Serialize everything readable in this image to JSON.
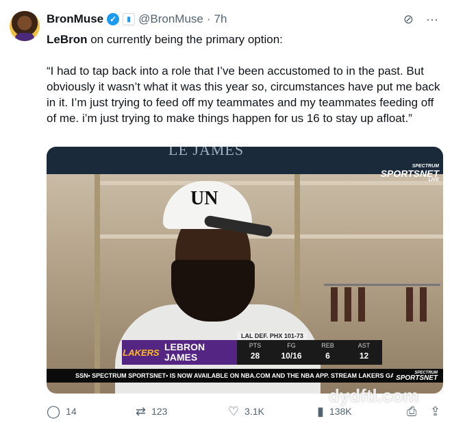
{
  "author": {
    "display_name": "BronMuse",
    "handle": "@BronMuse",
    "separator": "·",
    "time": "7h"
  },
  "tweet": {
    "lead_name": "LeBron",
    "lead_rest": " on currently being the primary option:",
    "quote": "“I had to tap back into a role that I’ve been accustomed to in the past. But obviously it wasn’t what it was this year so, circumstances have put me back in it. I’m just trying to feed off my teammates and my teammates feeding off of me. i’m just trying to make things happen for us 16 to stay up afloat.”"
  },
  "media": {
    "locker_nameplate": "LE JAMES",
    "cap_text": "UN",
    "broadcaster_logo_small": "SPECTRUM",
    "broadcaster_logo_big": "SPORTSNET",
    "broadcaster_logo_live": "LIVE",
    "lower_third": {
      "meta": "LAL DEF. PHX 101-73",
      "team_logo": "LAKERS",
      "player_first": "LEBRON",
      "player_last": "JAMES",
      "stats": [
        {
          "label": "PTS",
          "value": "28"
        },
        {
          "label": "FG",
          "value": "10/16"
        },
        {
          "label": "REB",
          "value": "6"
        },
        {
          "label": "AST",
          "value": "12"
        }
      ]
    },
    "ticker_text": "SSN• SPECTRUM SPORTSNET• IS NOW AVAILABLE ON NBA.COM AND THE NBA APP. STREAM LAKERS GAMES O",
    "ticker_logo_small": "SPECTRUM",
    "ticker_logo_big": "SPORTSNET"
  },
  "actions": {
    "replies": "14",
    "retweets": "123",
    "likes": "3.1K",
    "views": "138K"
  },
  "watermark": "dydftl.com",
  "icons": {
    "verified": "verified-check-icon",
    "affiliate": "affiliate-badge-icon",
    "grok": "grok-icon",
    "more": "more-icon",
    "reply": "reply-icon",
    "retweet": "retweet-icon",
    "like": "heart-icon",
    "views": "views-icon",
    "bookmark": "bookmark-icon",
    "share": "share-icon"
  },
  "colors": {
    "accent": "#1d9bf0",
    "lakers_purple": "#552583",
    "lakers_gold": "#fdb927"
  }
}
